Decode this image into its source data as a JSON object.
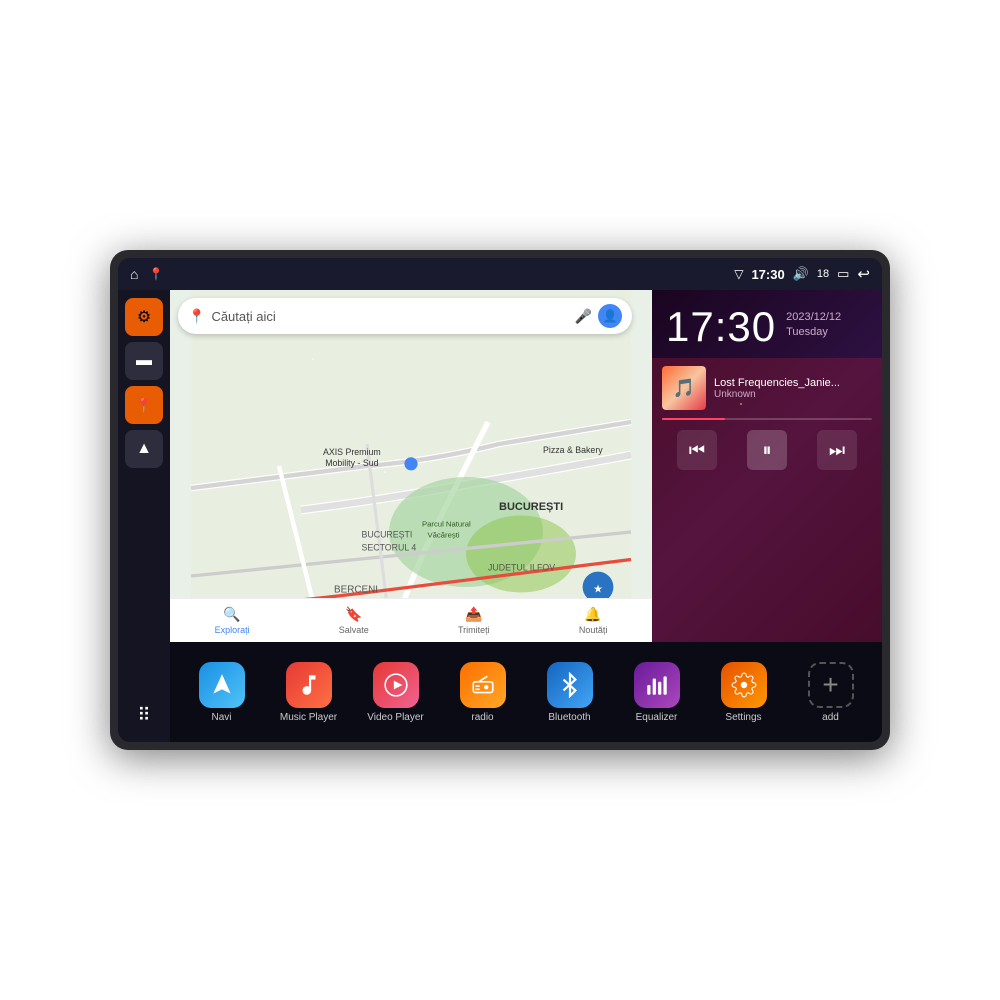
{
  "device": {
    "status_bar": {
      "wifi_icon": "▼",
      "time": "17:30",
      "volume_icon": "🔊",
      "battery_level": "18",
      "battery_icon": "🔋",
      "back_icon": "↩"
    },
    "sidebar": {
      "buttons": [
        {
          "name": "settings",
          "label": "⚙",
          "style": "orange"
        },
        {
          "name": "folder",
          "label": "▬",
          "style": "dark"
        },
        {
          "name": "map",
          "label": "📍",
          "style": "orange"
        },
        {
          "name": "nav",
          "label": "▲",
          "style": "dark"
        },
        {
          "name": "grid",
          "label": "⋯",
          "style": "grid"
        }
      ]
    },
    "map": {
      "search_placeholder": "Căutați aici",
      "tabs": [
        {
          "label": "Explorați",
          "icon": "🔍"
        },
        {
          "label": "Salvate",
          "icon": "🔖"
        },
        {
          "label": "Trimiteți",
          "icon": "📤"
        },
        {
          "label": "Noutăți",
          "icon": "🔔"
        }
      ],
      "locations": [
        "AXIS Premium Mobility - Sud",
        "Pizza & Bakery",
        "Parcul Natural Văcărești",
        "BUCUREȘTI",
        "BUCUREȘTI SECTORUL 4",
        "JUDEȚUL ILFOV",
        "BERCENI"
      ]
    },
    "clock": {
      "time": "17:30",
      "date": "2023/12/12",
      "day": "Tuesday"
    },
    "music": {
      "title": "Lost Frequencies_Janie...",
      "artist": "Unknown",
      "progress": 30
    },
    "apps": [
      {
        "name": "Navi",
        "icon": "▲",
        "style": "navi"
      },
      {
        "name": "Music Player",
        "icon": "♪",
        "style": "music"
      },
      {
        "name": "Video Player",
        "icon": "▶",
        "style": "video"
      },
      {
        "name": "radio",
        "icon": "📻",
        "style": "radio"
      },
      {
        "name": "Bluetooth",
        "icon": "ᛒ",
        "style": "bluetooth"
      },
      {
        "name": "Equalizer",
        "icon": "≡",
        "style": "eq"
      },
      {
        "name": "Settings",
        "icon": "⚙",
        "style": "settings"
      },
      {
        "name": "add",
        "icon": "+",
        "style": "add"
      }
    ]
  }
}
